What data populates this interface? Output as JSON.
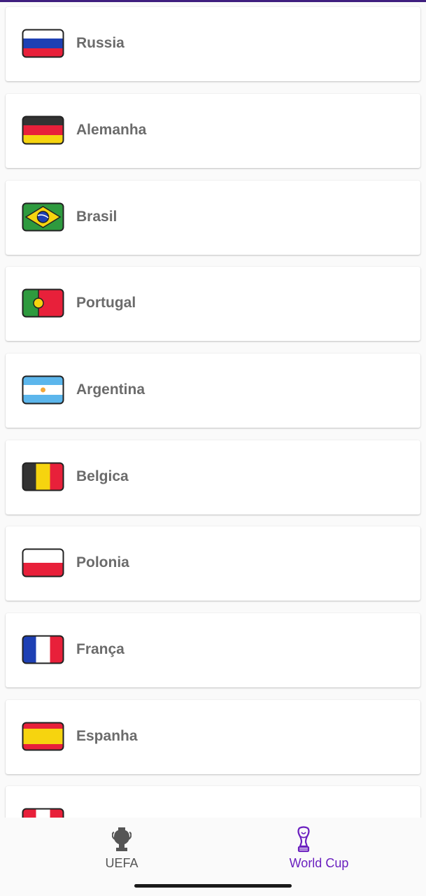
{
  "teams": [
    {
      "name": "Russia",
      "flag": "russia-flag-icon"
    },
    {
      "name": "Alemanha",
      "flag": "germany-flag-icon"
    },
    {
      "name": "Brasil",
      "flag": "brazil-flag-icon"
    },
    {
      "name": "Portugal",
      "flag": "portugal-flag-icon"
    },
    {
      "name": "Argentina",
      "flag": "argentina-flag-icon"
    },
    {
      "name": "Belgica",
      "flag": "belgium-flag-icon"
    },
    {
      "name": "Polonia",
      "flag": "poland-flag-icon"
    },
    {
      "name": "França",
      "flag": "france-flag-icon"
    },
    {
      "name": "Espanha",
      "flag": "spain-flag-icon"
    },
    {
      "name": "",
      "flag": "partially-visible-flag-icon"
    }
  ],
  "bottom_nav": {
    "items": [
      {
        "label": "UEFA",
        "icon": "uefa-trophy-icon",
        "active": false
      },
      {
        "label": "World Cup",
        "icon": "world-cup-trophy-icon",
        "active": true
      }
    ]
  },
  "colors": {
    "accent": "#6a1fbf",
    "top_bar": "#3f1f7f",
    "card_text": "#6b6b6b",
    "inactive_nav": "#555555",
    "background": "#fafafa"
  }
}
